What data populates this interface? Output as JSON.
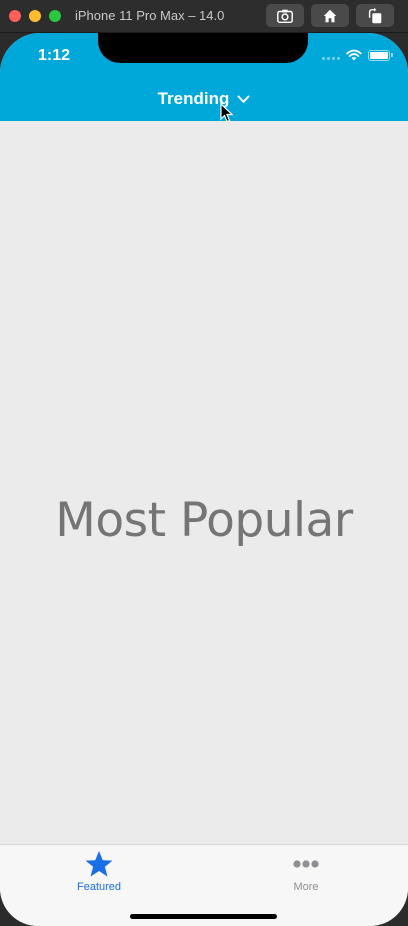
{
  "simulator": {
    "title": "iPhone 11 Pro Max – 14.0",
    "buttons": [
      {
        "icon": "screenshot-icon"
      },
      {
        "icon": "home-icon"
      },
      {
        "icon": "rotate-icon"
      }
    ]
  },
  "status_bar": {
    "time": "1:12",
    "wifi_icon": "wifi-icon",
    "battery_icon": "battery-icon"
  },
  "nav": {
    "title": "Trending",
    "dropdown_icon": "chevron-down-icon"
  },
  "main": {
    "label": "Most Popular"
  },
  "tabbar": {
    "tabs": [
      {
        "label": "Featured",
        "icon": "star-icon",
        "selected": true
      },
      {
        "label": "More",
        "icon": "more-icon",
        "selected": false
      }
    ]
  },
  "colors": {
    "header": "#00a8d9",
    "tab_active": "#1a6fe8",
    "tab_inactive": "#8e8e93",
    "content_bg": "#ebebeb"
  }
}
